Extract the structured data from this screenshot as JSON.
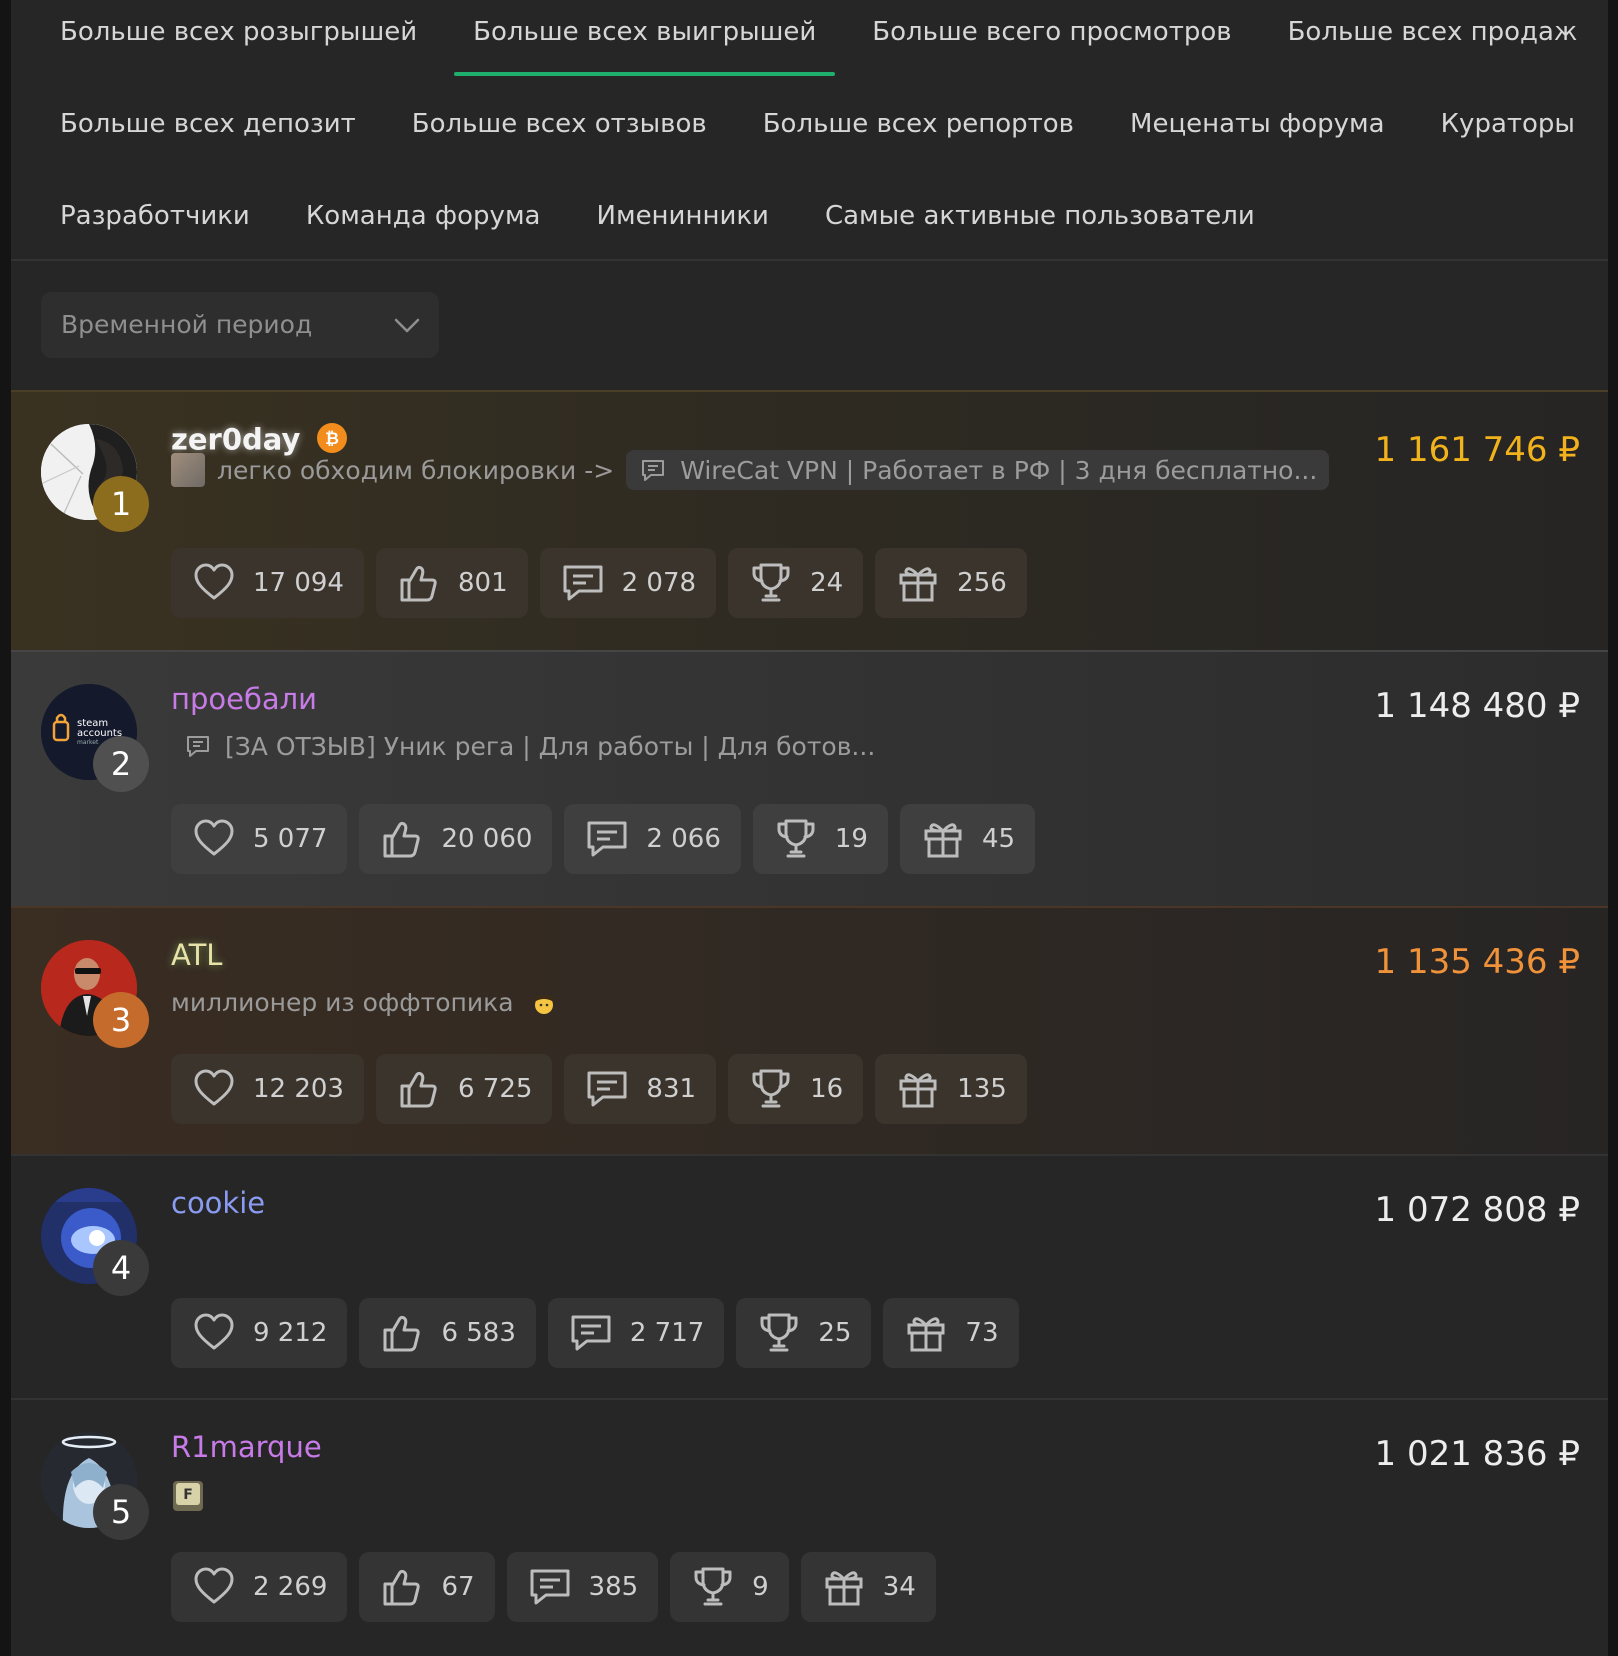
{
  "tabs": {
    "row1": [
      "Больше всех розыгрышей",
      "Больше всех выигрышей",
      "Больше всего просмотров",
      "Больше всех продаж"
    ],
    "row2": [
      "Больше всех депозит",
      "Больше всех отзывов",
      "Больше всех репортов",
      "Меценаты форума",
      "Кураторы"
    ],
    "row3": [
      "Разработчики",
      "Команда форума",
      "Именинники",
      "Самые активные пользователи"
    ],
    "active": "Больше всех выигрышей"
  },
  "filter": {
    "period_placeholder": "Временной период"
  },
  "users": [
    {
      "rank": "1",
      "name": "zer0day",
      "status_text": "легко обходим блокировки ->",
      "thread": "WireCat VPN | Работает в РФ | 3 дня бесплатно...",
      "amount": "1 161 746 ₽",
      "stats": {
        "likes": "17 094",
        "thumbs": "801",
        "messages": "2 078",
        "trophies": "24",
        "gifts": "256"
      },
      "name_color": "#f2f2f2",
      "amount_color": "#f2b21c",
      "badge_icon": "bitcoin-icon"
    },
    {
      "rank": "2",
      "name": "проебали",
      "thread": "[ЗА ОТЗЫВ] Уник рега | Для работы | Для ботов...",
      "amount": "1 148 480 ₽",
      "stats": {
        "likes": "5 077",
        "thumbs": "20 060",
        "messages": "2 066",
        "trophies": "19",
        "gifts": "45"
      },
      "name_color": "#c77be6",
      "amount_color": "#ededed"
    },
    {
      "rank": "3",
      "name": "ATL",
      "status_text": "миллионер из оффтопика",
      "amount": "1 135 436 ₽",
      "stats": {
        "likes": "12 203",
        "thumbs": "6 725",
        "messages": "831",
        "trophies": "16",
        "gifts": "135"
      },
      "name_color": "#e8e2a8",
      "amount_color": "#f0923a"
    },
    {
      "rank": "4",
      "name": "cookie",
      "amount": "1 072 808 ₽",
      "stats": {
        "likes": "9 212",
        "thumbs": "6 583",
        "messages": "2 717",
        "trophies": "25",
        "gifts": "73"
      },
      "name_color": "#8a9cf2",
      "amount_color": "#ededed"
    },
    {
      "rank": "5",
      "name": "R1marque",
      "amount": "1 021 836 ₽",
      "stats": {
        "likes": "2 269",
        "thumbs": "67",
        "messages": "385",
        "trophies": "9",
        "gifts": "34"
      },
      "name_color": "#c77be6",
      "amount_color": "#ededed"
    }
  ]
}
